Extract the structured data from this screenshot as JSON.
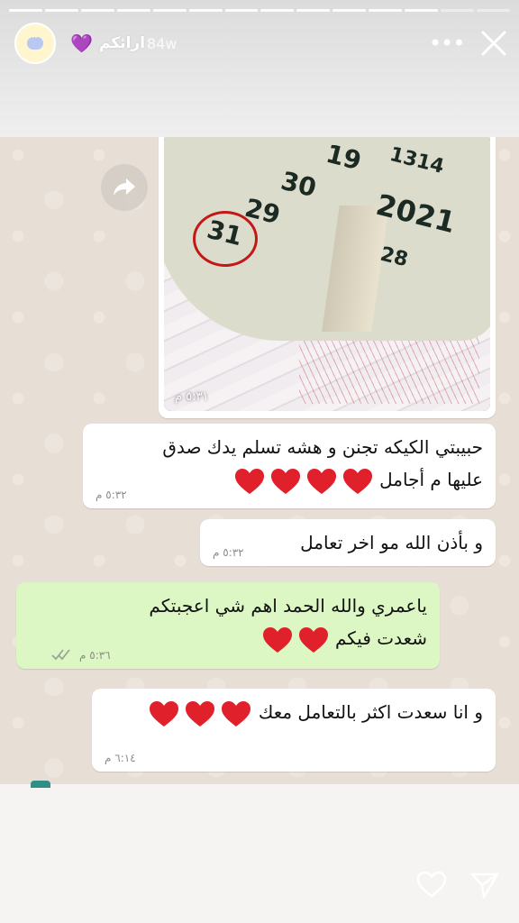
{
  "story": {
    "user_name": "ارائكم",
    "time_ago": "84w",
    "heart_emoji": "💜",
    "progress_segments": 14,
    "progress_current": 12,
    "icons": {
      "avatar": "chat-bubble-avatar-icon",
      "more": "more-horizontal-icon",
      "close": "close-icon"
    }
  },
  "chat": {
    "photo_message": {
      "time": "٥:٣١ م",
      "numbers": [
        "19",
        "1314",
        "2021",
        "29",
        "31",
        "28",
        "30"
      ]
    },
    "messages": [
      {
        "direction": "in",
        "text": "حبيبتي الكيكه تجنن و هشه تسلم يدك صدق",
        "text2": "عليها م أجامل",
        "hearts": 4,
        "time": "٥:٣٢ م"
      },
      {
        "direction": "in",
        "text": "و بأذن الله مو اخر تعامل",
        "text2": "",
        "hearts": 0,
        "time": "٥:٣٢ م"
      },
      {
        "direction": "out",
        "text": "ياعمري والله الحمد اهم شي اعجبتكم",
        "text2": "شعدت فيكم",
        "hearts": 2,
        "time": "٥:٣٦ م"
      },
      {
        "direction": "in",
        "text": "و انا سعدت اكثر بالتعامل معك",
        "text2": "",
        "hearts": 3,
        "time": "٦:١٤ م"
      }
    ]
  },
  "colors": {
    "incoming_bubble": "#ffffff",
    "outgoing_bubble": "#dcf7c4",
    "heart": "#e0202a",
    "story_accent": "#8e3bd6"
  },
  "footer": {
    "icons": {
      "like": "heart-outline-icon",
      "send": "send-icon"
    }
  }
}
